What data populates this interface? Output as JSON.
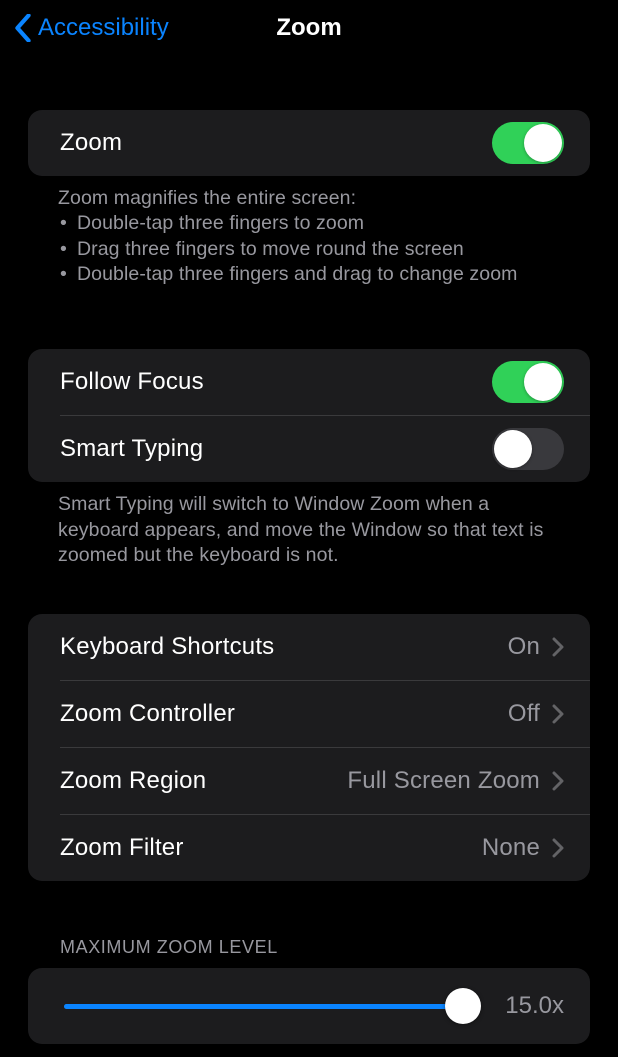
{
  "nav": {
    "back_label": "Accessibility",
    "title": "Zoom"
  },
  "group1": {
    "zoom_label": "Zoom",
    "zoom_on": true,
    "footer_intro": "Zoom magnifies the entire screen:",
    "footer_bullets": [
      "Double-tap three fingers to zoom",
      "Drag three fingers to move round the screen",
      "Double-tap three fingers and drag to change zoom"
    ]
  },
  "group2": {
    "follow_focus_label": "Follow Focus",
    "follow_focus_on": true,
    "smart_typing_label": "Smart Typing",
    "smart_typing_on": false,
    "footer": "Smart Typing will switch to Window Zoom when a keyboard appears, and move the Window so that text is zoomed but the keyboard is not."
  },
  "group3": {
    "keyboard_shortcuts_label": "Keyboard Shortcuts",
    "keyboard_shortcuts_value": "On",
    "zoom_controller_label": "Zoom Controller",
    "zoom_controller_value": "Off",
    "zoom_region_label": "Zoom Region",
    "zoom_region_value": "Full Screen Zoom",
    "zoom_filter_label": "Zoom Filter",
    "zoom_filter_value": "None"
  },
  "slider": {
    "header": "MAXIMUM ZOOM LEVEL",
    "value_display": "15.0x",
    "value": 15.0,
    "min": 1.2,
    "max": 15.0
  }
}
